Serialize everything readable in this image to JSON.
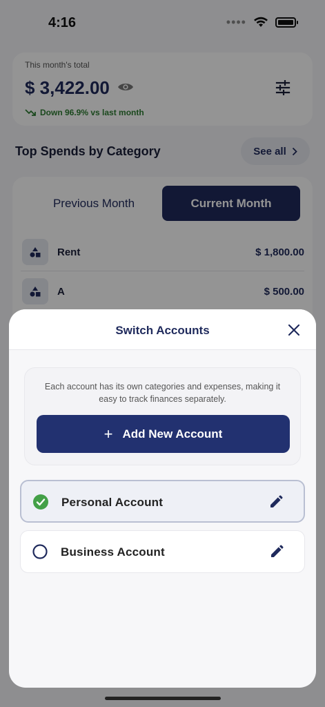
{
  "status_bar": {
    "time": "4:16",
    "dots": "••••"
  },
  "summary": {
    "caption": "This month's total",
    "amount": "$ 3,422.00",
    "trend": "Down 96.9% vs last month",
    "trend_color": "#2e7d32"
  },
  "top_spends": {
    "title": "Top Spends by Category",
    "see_all": "See all",
    "tabs": [
      "Previous Month",
      "Current Month"
    ],
    "selected_tab": "Current Month",
    "categories": [
      {
        "name": "Rent",
        "amount": "$ 1,800.00",
        "icon": "shapes-icon"
      },
      {
        "name": "A",
        "amount": "$ 500.00",
        "icon": "shapes-icon"
      }
    ]
  },
  "sheet": {
    "title": "Switch Accounts",
    "info": "Each account has its own categories and expenses, making it easy to track finances separately.",
    "add_button": "Add New Account",
    "add_symbol": "+",
    "accounts": [
      {
        "name": "Personal Account",
        "selected": true
      },
      {
        "name": "Business Account",
        "selected": false
      }
    ]
  },
  "colors": {
    "brand_navy": "#1f2a5c",
    "button_navy": "#223170",
    "check_green": "#43a047"
  }
}
